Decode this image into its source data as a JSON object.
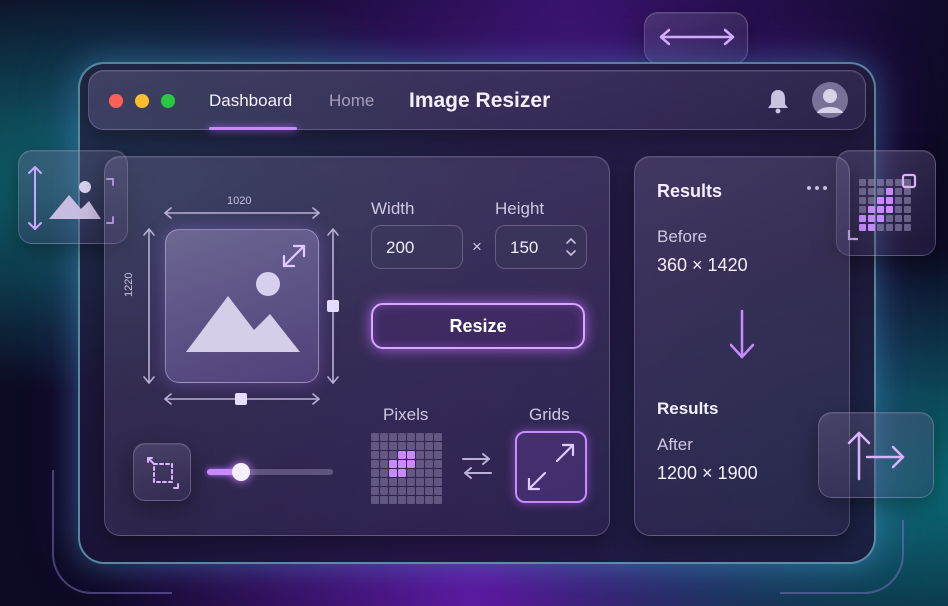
{
  "window": {
    "title": "Image Resizer",
    "tabs": [
      {
        "label": "Dashboard",
        "active": true
      },
      {
        "label": "Home",
        "active": false
      }
    ],
    "traffic_lights": [
      "#ff5f57",
      "#febc2e",
      "#28c840"
    ],
    "icons": {
      "notification": "bell-icon",
      "profile": "user-avatar-icon"
    }
  },
  "editor": {
    "preview_width_label": "1020",
    "preview_height_label": "1220",
    "width_label": "Width",
    "height_label": "Height",
    "width_value": "200",
    "height_value": "150",
    "times_symbol": "×",
    "resize_label": "Resize",
    "pixels_label": "Pixels",
    "grids_label": "Grids",
    "slider_fraction": 0.27
  },
  "results": {
    "title": "Results",
    "before_label": "Before",
    "before_value": "360 × 1420",
    "section_title": "Results",
    "after_label": "After",
    "after_value": "1200 × 1900"
  },
  "colors": {
    "accent": "#c78bff",
    "accent_glow": "#b06aff",
    "frame_edge": "#8ce6f0"
  }
}
